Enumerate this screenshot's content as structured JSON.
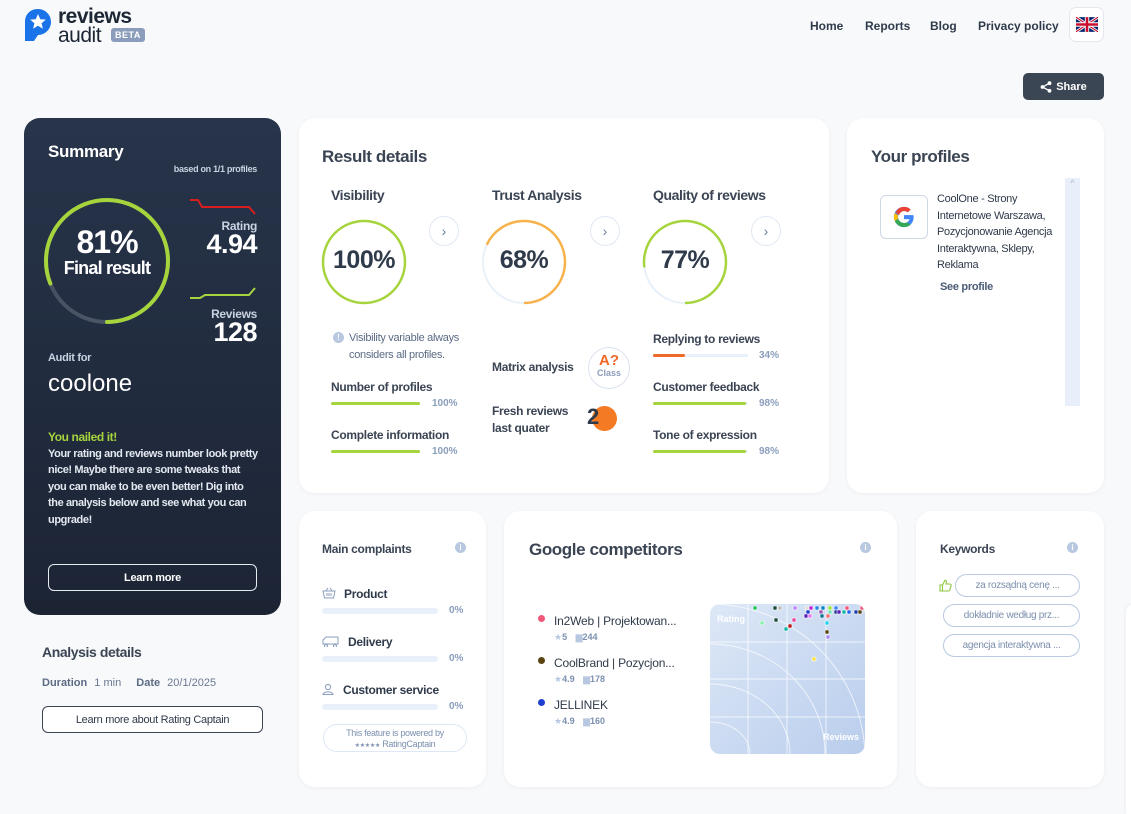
{
  "header": {
    "logo_line1": "reviews",
    "logo_line2": "audit",
    "beta_badge": "BETA",
    "nav": [
      "Home",
      "Reports",
      "Blog",
      "Privacy policy"
    ],
    "language_icon": "uk-flag-icon",
    "share_label": "Share"
  },
  "summary": {
    "title": "Summary",
    "based_on": "based on 1/1 profiles",
    "final_percent": "81%",
    "final_value": 0.81,
    "final_label": "Final result",
    "rating_label": "Rating",
    "rating_value": "4.94",
    "reviews_label": "Reviews",
    "reviews_value": "128",
    "audit_for_label": "Audit for",
    "audit_name": "coolone",
    "verdict_title": "You nailed it!",
    "verdict_text": "Your rating and reviews number look pretty nice! Maybe there are some tweaks that you can make to be even better! Dig into the analysis below and see what you can upgrade!",
    "learn_more": "Learn more",
    "colors": {
      "accent_green": "#a6d43d",
      "rating_trend": "#d81e1e"
    }
  },
  "analysis": {
    "title": "Analysis details",
    "duration_label": "Duration",
    "duration_value": "1 min",
    "date_label": "Date",
    "date_value": "20/1/2025",
    "rc_button": "Learn more about Rating Captain"
  },
  "result_details": {
    "title": "Result details",
    "columns": [
      {
        "title": "Visibility",
        "percent": "100%",
        "value": 1.0,
        "color": "#a6d43d"
      },
      {
        "title": "Trust Analysis",
        "percent": "68%",
        "value": 0.68,
        "color": "#f7b24c"
      },
      {
        "title": "Quality of reviews",
        "percent": "77%",
        "value": 0.77,
        "color": "#a6d43d"
      }
    ],
    "visibility_note": "Visibility variable always considers all profiles.",
    "visibility_metrics": [
      {
        "label": "Number of profiles",
        "percent": "100%",
        "value": 1.0,
        "color": "#a6d43d"
      },
      {
        "label": "Complete information",
        "percent": "100%",
        "value": 1.0,
        "color": "#a6d43d"
      }
    ],
    "matrix_label": "Matrix analysis",
    "matrix_class": "A?",
    "matrix_class_sub": "Class",
    "fresh_label_1": "Fresh reviews",
    "fresh_label_2": "last quater",
    "fresh_value": "2",
    "quality_metrics": [
      {
        "label": "Replying to reviews",
        "percent": "34%",
        "value": 0.34,
        "color": "#f0692a"
      },
      {
        "label": "Customer feedback",
        "percent": "98%",
        "value": 0.98,
        "color": "#a6d43d"
      },
      {
        "label": "Tone of expression",
        "percent": "98%",
        "value": 0.98,
        "color": "#a6d43d"
      }
    ]
  },
  "profiles": {
    "title": "Your profiles",
    "items": [
      {
        "icon": "google-icon",
        "name": "CoolOne - Strony Internetowe Warszawa, Pozycjonowanie Agencja Interaktywna, Sklepy, Reklama",
        "link": "See profile"
      }
    ]
  },
  "complaints": {
    "title": "Main complaints",
    "items": [
      {
        "icon": "basket-icon",
        "label": "Product",
        "percent": "0%",
        "value": 0
      },
      {
        "icon": "van-icon",
        "label": "Delivery",
        "percent": "0%",
        "value": 0
      },
      {
        "icon": "user-icon",
        "label": "Customer service",
        "percent": "0%",
        "value": 0
      }
    ],
    "powered_line1": "This feature is powered by",
    "powered_line2": "RatingCaptain"
  },
  "competitors": {
    "title": "Google competitors",
    "items": [
      {
        "name": "In2Web | Projektowan...",
        "rating": "5",
        "reviews": "244",
        "color": "#f0587a"
      },
      {
        "name": "CoolBrand | Pozycjon...",
        "rating": "4.9",
        "reviews": "178",
        "color": "#5a4510"
      },
      {
        "name": "JELLINEK",
        "rating": "4.9",
        "reviews": "160",
        "color": "#1f3fd0"
      }
    ],
    "scatter_label_y": "Rating",
    "scatter_label_x": "Reviews"
  },
  "keywords": {
    "title": "Keywords",
    "items": [
      "za rozsądną cenę ...",
      "dokładnie według prz...",
      "agencja interaktywna ..."
    ]
  }
}
